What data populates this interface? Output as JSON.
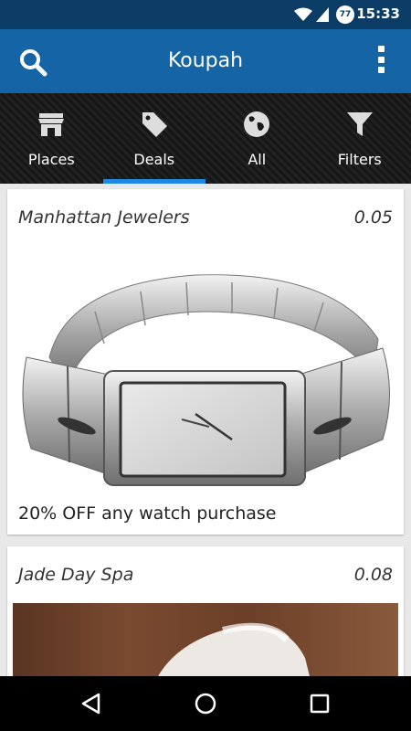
{
  "status_bar": {
    "time": "15:33",
    "notification_badge": "77"
  },
  "app_bar": {
    "title": "Koupah"
  },
  "tabs": [
    {
      "label": "Places",
      "icon": "store-icon"
    },
    {
      "label": "Deals",
      "icon": "tag-icon",
      "active": true
    },
    {
      "label": "All",
      "icon": "globe-icon"
    },
    {
      "label": "Filters",
      "icon": "filter-icon"
    }
  ],
  "deals": [
    {
      "name": "Manhattan Jewelers",
      "distance": "0.05",
      "description": "20% OFF any watch purchase",
      "image": "wristwatch-photo"
    },
    {
      "name": "Jade Day Spa",
      "distance": "0.08",
      "description": "",
      "image": "spa-stone-photo"
    }
  ],
  "colors": {
    "status_bar": "#0b3c66",
    "app_bar": "#1565a6",
    "tab_indicator": "#1e88e5"
  }
}
